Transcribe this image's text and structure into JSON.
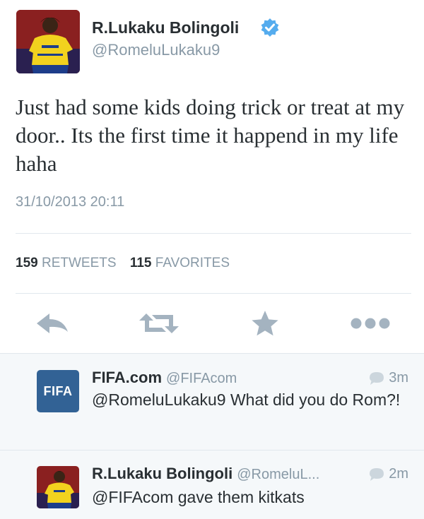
{
  "tweet": {
    "author_name": "R.Lukaku Bolingoli",
    "author_handle": "@RomeluLukaku9",
    "text": "Just had some kids doing trick or treat at my door.. Its the first time it happend in my life haha",
    "timestamp": "31/10/2013 20:11",
    "retweets_count": "159",
    "retweets_label": "RETWEETS",
    "favorites_count": "115",
    "favorites_label": "FAVORITES"
  },
  "actions": {
    "reply_icon": "reply-arrow-icon",
    "retweet_icon": "retweet-icon",
    "favorite_icon": "star-icon",
    "more_icon": "more-dots-icon"
  },
  "replies": [
    {
      "name": "FIFA.com",
      "handle": "@FIFAcom",
      "time": "3m",
      "text": "@RomeluLukaku9 What did you do Rom?!",
      "avatar_text": "FIFA"
    },
    {
      "name": "R.Lukaku Bolingoli",
      "handle": "@RomeluL...",
      "time": "2m",
      "text": "@FIFAcom gave them kitkats"
    }
  ],
  "colors": {
    "text_primary": "#292f33",
    "text_secondary": "#8899a6",
    "verified_blue": "#55acee",
    "icon_gray": "#a4b3c0",
    "fifa_blue": "#326295",
    "reply_bg": "#f5f8fa"
  }
}
